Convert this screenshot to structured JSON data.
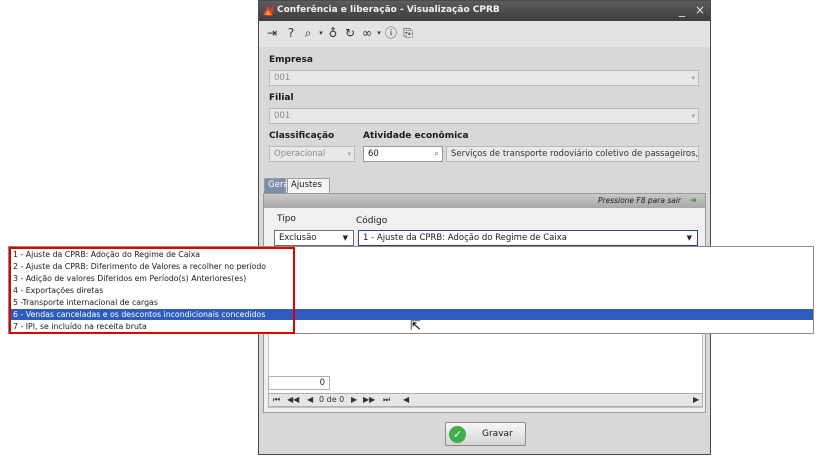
{
  "window": {
    "title": "Conferência e liberação - Visualização CPRB",
    "controls": {
      "minimize": "_",
      "close": "×"
    }
  },
  "toolbar": {
    "icons": [
      "exit-icon",
      "help-icon",
      "zoom-icon",
      "lightbulb-icon",
      "refresh-icon",
      "link-icon",
      "info-icon",
      "export-icon"
    ]
  },
  "form": {
    "empresa": {
      "label": "Empresa",
      "value": "001"
    },
    "filial": {
      "label": "Filial",
      "value": "001"
    },
    "classificacao": {
      "label": "Classificação",
      "value": "Operacional"
    },
    "atividade": {
      "label": "Atividade econômica",
      "code": "60",
      "description": "Serviços de transporte rodoviário coletivo de passageiros, ..."
    }
  },
  "tabs": [
    {
      "label": "Geral"
    },
    {
      "label": "Ajustes"
    }
  ],
  "panel": {
    "hint": "Pressione F8 para sair",
    "tipo_label": "Tipo",
    "tipo_value": "Exclusão",
    "codigo_label": "Código",
    "codigo_value": "1 - Ajuste da CPRB: Adoção do Regime de Caixa",
    "count": "0",
    "pager": {
      "first": "⏮",
      "prev_page": "◀◀",
      "prev": "◀",
      "position": "0 de 0",
      "next": "▶",
      "next_page": "▶▶",
      "last": "⏭",
      "scroll_left": "◀",
      "scroll_right": "▶"
    }
  },
  "dropdown": {
    "options": [
      "1 - Ajuste da CPRB: Adoção do Regime de Caixa",
      "2 - Ajuste da CPRB: Diferimento de Valores a recolher no período",
      "3 - Adição de valores Diferidos em Período(s) Anteriores(es)",
      "4 - Exportações diretas",
      "5 -Transporte internacional de cargas",
      "6 - Vendas canceladas e os descontos incondicionais concedidos",
      "7 - IPI, se incluído na receita bruta"
    ],
    "selected_index": 5
  },
  "save_button": {
    "label": "Gravar"
  },
  "colors": {
    "selection": "#2f5cbc",
    "highlight_box": "#e00000",
    "titlebar": "#4a4a4a"
  }
}
